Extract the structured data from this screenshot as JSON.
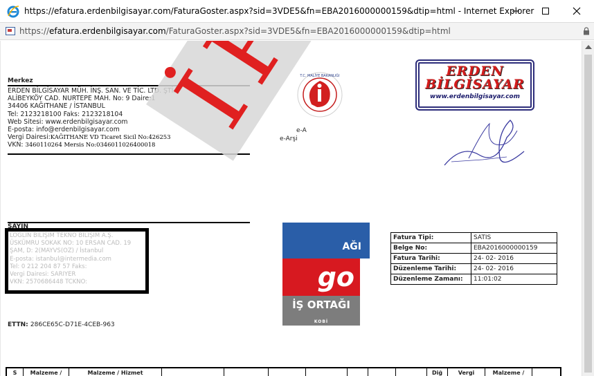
{
  "window": {
    "title": "https://efatura.erdenbilgisayar.com/FaturaGoster.aspx?sid=3VDE5&fn=EBA2016000000159&dtip=html - Internet Explorer"
  },
  "address": {
    "scheme": "https://",
    "host": "efatura.erdenbilgisayar.com",
    "path": "/FaturaGoster.aspx?sid=3VDE5&fn=EBA2016000000159&dtip=html"
  },
  "seller": {
    "heading": "Merkez",
    "name": "ERDEN BİLGİSAYAR MÜH. İNŞ. SAN. VE TİC. LTD. ŞTİ.",
    "address1": "ALİBEYKÖY CAD. NURTEPE MAH.   No: 9 Daire:1",
    "address2": "34406   KAĞITHANE / İSTANBUL",
    "phone": "Tel:  2123218100 Faks: 2123218104",
    "web": "Web Sitesi:  www.erdenbilgisayar.com",
    "email": "E-posta: info@erdenbilgisayar.com",
    "tax_office_label": "Vergi Dairesi:",
    "tax_office_value": "KAĞITHANE VD Ticaret Sicil No:426253",
    "vkn_label": "VKN: ",
    "vkn_value": "3460110264 Mersis No:0346011026400018"
  },
  "gib_logo_text": "T.C. MALİYE BAKANLIĞI",
  "earsiv": {
    "line1": "e-A",
    "line2": "e-Arşi"
  },
  "brand": {
    "line1": "ERDEN",
    "line2": "BİLGİSAYAR",
    "url": "www.erdenbilgisayar.com"
  },
  "buyer": {
    "heading": "SAYIN",
    "lines": [
      "LOGLIN BILIŞIM TEKNO BİLİŞİM A.Ş.",
      "ÜSKÜMRU SOKAK NO: 10 ERSAN CAD. 19",
      "    ŞAM, D: 2(MAYVS(OZ) / İstanbul",
      "E-posta:  istanbul@intermedia.com",
      "Tel:  0 212 204 87 57 Faks:",
      "Vergi Dairesi:  SARIYER",
      "VKN: 2570686448  TCKNO:"
    ]
  },
  "partner": {
    "top": "AĞI",
    "logo": "go",
    "middle": "İŞ ORTAĞI",
    "bottom": "KOBİ"
  },
  "invoice": {
    "rows": [
      {
        "key": "Fatura Tipi:",
        "value": "SATIS"
      },
      {
        "key": "Belge No:",
        "value": "EBA2016000000159"
      },
      {
        "key": "Fatura Tarihi:",
        "value": "24- 02- 2016"
      },
      {
        "key": "Düzenleme Tarihi:",
        "value": "24- 02- 2016"
      },
      {
        "key": "Düzenleme Zamanı:",
        "value": "11:01:02"
      }
    ]
  },
  "ettn": {
    "label": "ETTN: ",
    "value": "286CE65C-D71E-4CEB-963"
  },
  "items_header": [
    "S",
    "Malzeme /",
    "Malzeme / Hizmet",
    "",
    "",
    "",
    "",
    "",
    "",
    "",
    "Diğ",
    "Vergi",
    "Malzeme /",
    ""
  ],
  "watermark": "İPTAL",
  "colors": {
    "watermark_red": "#e02020",
    "brand_red": "#d41c1c",
    "brand_blue": "#2c2c7a",
    "partner_blue": "#2a5ea8",
    "partner_red": "#d71920"
  }
}
